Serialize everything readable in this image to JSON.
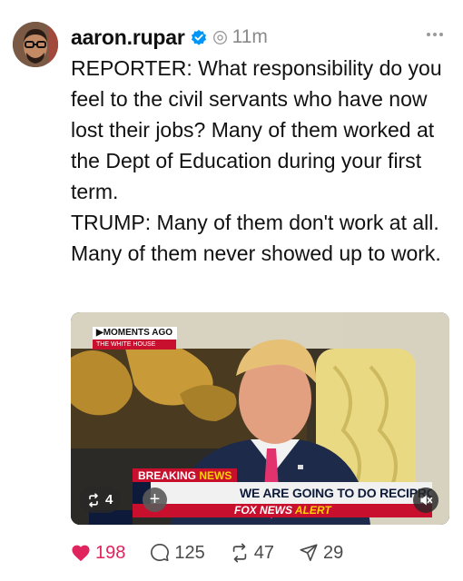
{
  "post": {
    "username": "aaron.rupar",
    "time": "11m",
    "paragraphs": [
      "REPORTER: What responsibility do you feel to the civil servants who have now lost their jobs? Many of them worked at the Dept of Education during your first term.",
      "TRUMP: Many of them don't work at all. Many of them never showed up to work."
    ]
  },
  "video": {
    "tag_top": "MOMENTS AGO",
    "tag_bottom": "THE WHITE HOUSE",
    "breaking_1": "BREAKING",
    "breaking_2": "NEWS",
    "ticker": "WE ARE GOING TO DO RECIPROCAL TARIF",
    "alert_1": "FOX NEWS",
    "alert_2": "ALERT",
    "repost_count": "4",
    "plus": "+"
  },
  "actions": {
    "likes": "198",
    "replies": "125",
    "reposts": "47",
    "shares": "29"
  },
  "colors": {
    "like": "#e0245e",
    "verified": "#0095f6",
    "fox_red": "#c8102e"
  },
  "icons": [
    "verified-badge-icon",
    "thread-icon",
    "more-icon",
    "repost-icon",
    "plus-icon",
    "mute-icon",
    "heart-icon",
    "reply-icon",
    "repost-icon",
    "share-icon"
  ]
}
